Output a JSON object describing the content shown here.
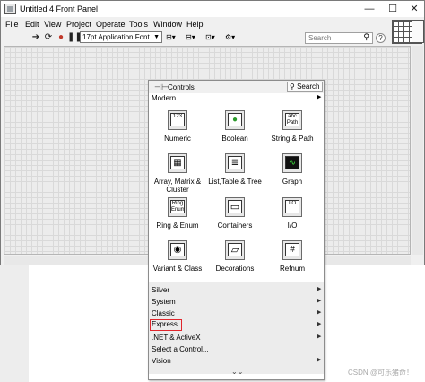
{
  "window": {
    "title": "Untitled 4 Front Panel",
    "controls": {
      "minimize": "—",
      "maximize": "☐",
      "close": "✕"
    }
  },
  "menubar": {
    "items": [
      "File",
      "Edit",
      "View",
      "Project",
      "Operate",
      "Tools",
      "Window",
      "Help"
    ]
  },
  "toolbar": {
    "font": "17pt Application Font",
    "search_placeholder": "Search",
    "help": "?"
  },
  "palette": {
    "title": "Controls",
    "search_label": "Search",
    "open_category": "Modern",
    "items": [
      {
        "label": "Numeric",
        "glyph": "123",
        "icon": "numeric-icon"
      },
      {
        "label": "Boolean",
        "glyph": "●",
        "icon": "boolean-icon"
      },
      {
        "label": "String & Path",
        "glyph": "abc Path",
        "icon": "string-path-icon"
      },
      {
        "label": "Array, Matrix & Cluster",
        "glyph": "▦",
        "icon": "array-icon"
      },
      {
        "label": "List,Table & Tree",
        "glyph": "≣",
        "icon": "list-table-icon"
      },
      {
        "label": "Graph",
        "glyph": "∿",
        "icon": "graph-icon"
      },
      {
        "label": "Ring & Enum",
        "glyph": "Ring Enum",
        "icon": "ring-enum-icon"
      },
      {
        "label": "Containers",
        "glyph": "▭",
        "icon": "containers-icon"
      },
      {
        "label": "I/O",
        "glyph": "I/O",
        "icon": "io-icon"
      },
      {
        "label": "Variant & Class",
        "glyph": "◉",
        "icon": "variant-icon"
      },
      {
        "label": "Decorations",
        "glyph": "▱",
        "icon": "decorations-icon"
      },
      {
        "label": "Refnum",
        "glyph": "#",
        "icon": "refnum-icon"
      }
    ],
    "categories": [
      "Silver",
      "System",
      "Classic",
      "Express",
      ".NET & ActiveX",
      "Select a Control...",
      "Vision"
    ],
    "highlighted_category": "Express"
  },
  "watermark": "CSDN @可乐猪命！",
  "colors": {
    "highlight_border": "#e0262c",
    "canvas_grid": "#d9d9d9"
  }
}
